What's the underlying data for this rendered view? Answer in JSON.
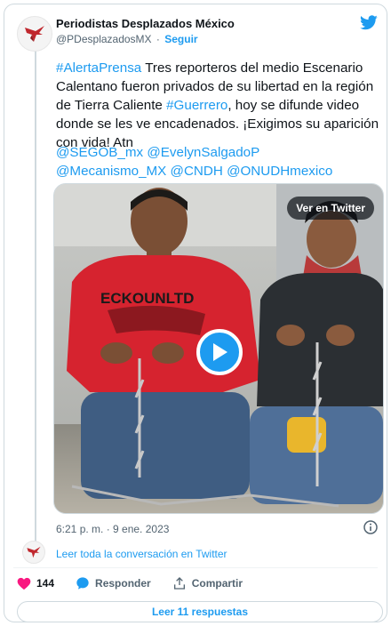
{
  "author": {
    "name": "Periodistas Desplazados México",
    "handle": "@PDesplazadosMX",
    "separator": "·",
    "follow_label": "Seguir"
  },
  "tweet": {
    "hashtag1": "#AlertaPrensa",
    "text1": " Tres reporteros del medio Escenario Calentano fueron privados de su libertad en la región de Tierra Caliente ",
    "hashtag2": "#Guerrero",
    "text2": ", hoy se difunde video donde se les ve encadenados. ¡Exigimos su aparición con vida! Atn",
    "mention1": "@SEGOB_mx",
    "mention2": "@EvelynSalgadoP",
    "mention3": "@Mecanismo_MX",
    "mention4": "@CNDH",
    "mention5": "@ONUDHmexico"
  },
  "media": {
    "view_on_twitter_label": "Ver en Twitter",
    "shirt_text": "ECKOUNLTD"
  },
  "timestamp": "6:21 p. m. · 9 ene. 2023",
  "read_conversation": "Leer toda la conversación en Twitter",
  "actions": {
    "likes": "144",
    "reply_label": "Responder",
    "share_label": "Compartir"
  },
  "read_replies": "Leer 11 respuestas",
  "colors": {
    "accent": "#1d9bf0",
    "like": "#f91880",
    "text": "#0f1419",
    "muted": "#536471"
  }
}
